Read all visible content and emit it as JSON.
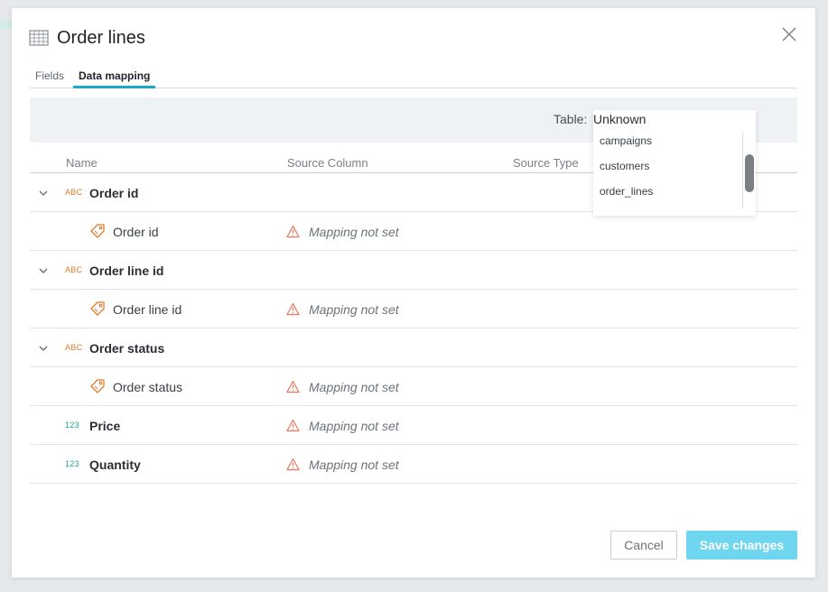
{
  "dialog": {
    "title": "Order lines",
    "tabs": [
      {
        "label": "Fields",
        "active": false
      },
      {
        "label": "Data mapping",
        "active": true
      }
    ]
  },
  "table_bar": {
    "label": "Table:",
    "value": "Unknown",
    "options": [
      "campaigns",
      "customers",
      "order_lines"
    ]
  },
  "columns": {
    "name": "Name",
    "source_column": "Source Column",
    "source_type": "Source Type"
  },
  "rows": [
    {
      "kind": "group",
      "type": "ABC",
      "name": "Order id"
    },
    {
      "kind": "sub",
      "name": "Order id",
      "mapping": "Mapping not set"
    },
    {
      "kind": "group",
      "type": "ABC",
      "name": "Order line id"
    },
    {
      "kind": "sub",
      "name": "Order line id",
      "mapping": "Mapping not set"
    },
    {
      "kind": "group",
      "type": "ABC",
      "name": "Order status"
    },
    {
      "kind": "sub",
      "name": "Order status",
      "mapping": "Mapping not set"
    },
    {
      "kind": "field",
      "type": "123",
      "name": "Price",
      "mapping": "Mapping not set"
    },
    {
      "kind": "field",
      "type": "123",
      "name": "Quantity",
      "mapping": "Mapping not set"
    }
  ],
  "buttons": {
    "cancel": "Cancel",
    "save": "Save changes"
  },
  "icons": {
    "title": "table-grid-icon",
    "close": "close-icon",
    "expand": "chevron-down-icon",
    "tag": "tag-icon",
    "warning": "warning-triangle-icon"
  },
  "colors": {
    "accent": "#1ba9c9",
    "save_button": "#6fd6f0",
    "abc_type": "#e07b2a",
    "number_type": "#1aa58a",
    "warning": "#e8755a"
  }
}
